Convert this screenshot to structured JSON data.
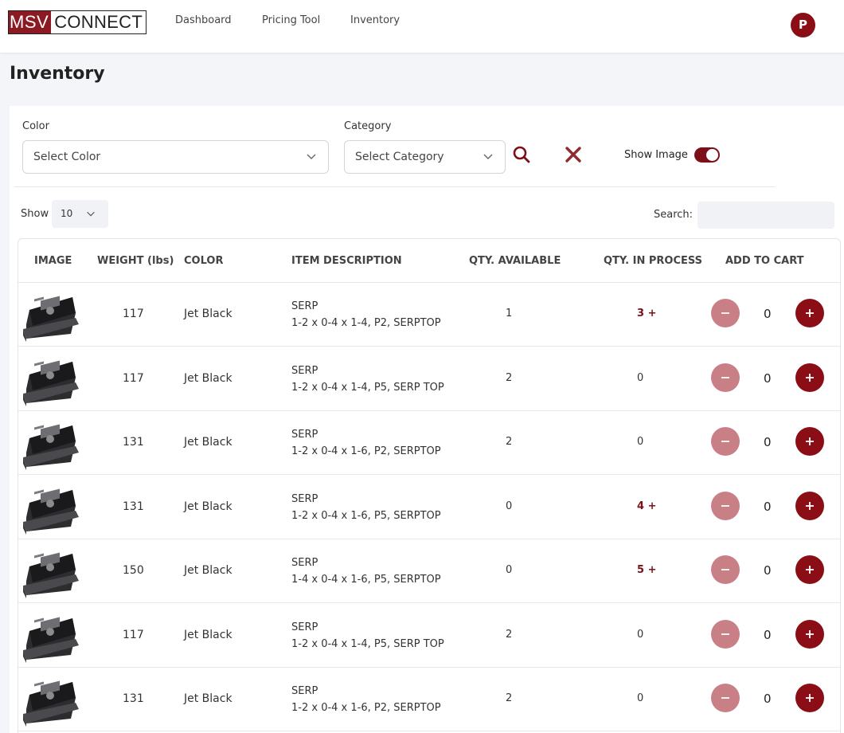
{
  "nav": {
    "logo_left": "MSV",
    "logo_right": "CONNECT",
    "links": [
      "Dashboard",
      "Pricing Tool",
      "Inventory"
    ],
    "avatar_initial": "P"
  },
  "page": {
    "title": "Inventory"
  },
  "filters": {
    "color_label": "Color",
    "color_placeholder": "Select Color",
    "category_label": "Category",
    "category_placeholder": "Select Category",
    "show_image_label": "Show Image",
    "show_image_on": true
  },
  "table_controls": {
    "show_label": "Show",
    "page_size": "10",
    "search_label": "Search:",
    "search_value": ""
  },
  "colors": {
    "brand": "#8b0d16",
    "minus_button": "#c97f86"
  },
  "table": {
    "headers": [
      "IMAGE",
      "WEIGHT (lbs)",
      "COLOR",
      "ITEM DESCRIPTION",
      "QTY. AVAILABLE",
      "QTY. IN PROCESS",
      "ADD TO CART"
    ],
    "rows": [
      {
        "weight": "117",
        "color": "Jet Black",
        "desc1": "SERP",
        "desc2": "1-2 x 0-4 x 1-4, P2, SERPTOP",
        "qty_available": "1",
        "qty_in_process": "3 +",
        "highlight": true,
        "cart_qty": "0"
      },
      {
        "weight": "117",
        "color": "Jet Black",
        "desc1": "SERP",
        "desc2": "1-2 x 0-4 x 1-4, P5, SERP TOP",
        "qty_available": "2",
        "qty_in_process": "0",
        "highlight": false,
        "cart_qty": "0"
      },
      {
        "weight": "131",
        "color": "Jet Black",
        "desc1": "SERP",
        "desc2": "1-2 x 0-4 x 1-6, P2, SERPTOP",
        "qty_available": "2",
        "qty_in_process": "0",
        "highlight": false,
        "cart_qty": "0"
      },
      {
        "weight": "131",
        "color": "Jet Black",
        "desc1": "SERP",
        "desc2": "1-2 x 0-4 x 1-6, P5, SERPTOP",
        "qty_available": "0",
        "qty_in_process": "4 +",
        "highlight": true,
        "cart_qty": "0"
      },
      {
        "weight": "150",
        "color": "Jet Black",
        "desc1": "SERP",
        "desc2": "1-4 x 0-4 x 1-6, P5, SERPTOP",
        "qty_available": "0",
        "qty_in_process": "5 +",
        "highlight": true,
        "cart_qty": "0"
      },
      {
        "weight": "117",
        "color": "Jet Black",
        "desc1": "SERP",
        "desc2": "1-2 x 0-4 x 1-4, P5, SERP TOP",
        "qty_available": "2",
        "qty_in_process": "0",
        "highlight": false,
        "cart_qty": "0"
      },
      {
        "weight": "131",
        "color": "Jet Black",
        "desc1": "SERP",
        "desc2": "1-2 x 0-4 x 1-6, P2, SERPTOP",
        "qty_available": "2",
        "qty_in_process": "0",
        "highlight": false,
        "cart_qty": "0"
      }
    ]
  }
}
